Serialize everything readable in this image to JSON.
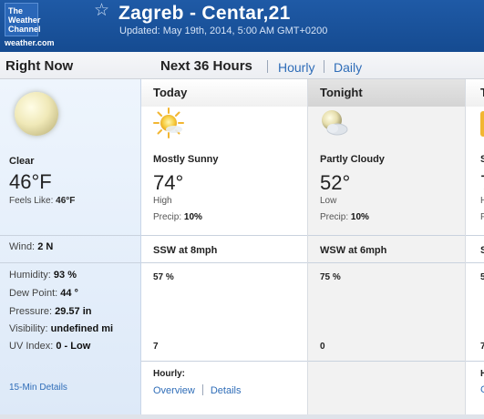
{
  "header": {
    "logo_line1": "The",
    "logo_line2": "Weather",
    "logo_line3": "Channel",
    "logo_url": "weather.com",
    "star_icon": "star-outline-icon",
    "city": "Zagreb - Centar,21",
    "updated": "Updated: May 19th, 2014, 5:00 AM GMT+0200"
  },
  "nav": {
    "right_now": "Right Now",
    "next36": "Next 36 Hours",
    "hourly": "Hourly",
    "daily": "Daily"
  },
  "right_now": {
    "icon": "full-moon-icon",
    "condition": "Clear",
    "temp": "46°F",
    "feels_label": "Feels Like:",
    "feels_value": "46°F",
    "wind_label": "Wind:",
    "wind_value": "2 N",
    "humidity_label": "Humidity:",
    "humidity_value": "93 %",
    "dewpoint_label": "Dew Point:",
    "dewpoint_value": "44 °",
    "pressure_label": "Pressure:",
    "pressure_value": "29.57 in",
    "visibility_label": "Visibility:",
    "visibility_value": "undefined mi",
    "uv_label": "UV Index:",
    "uv_value": "0 - Low",
    "details_link": "15-Min Details"
  },
  "today": {
    "title": "Today",
    "icon": "mostly-sunny-icon",
    "condition": "Mostly Sunny",
    "temp": "74°",
    "hl": "High",
    "precip_label": "Precip:",
    "precip_value": "10%",
    "wind": "SSW at 8mph",
    "humidity": "57 %",
    "uv": "7",
    "hourly_label": "Hourly:",
    "overview_link": "Overview",
    "details_link": "Details"
  },
  "tonight": {
    "title": "Tonight",
    "icon": "partly-cloudy-night-icon",
    "condition": "Partly Cloudy",
    "temp": "52°",
    "hl": "Low",
    "precip_label": "Precip:",
    "precip_value": "10%",
    "wind": "WSW at 6mph",
    "humidity": "75 %",
    "uv": "0"
  },
  "tomorrow_partial": {
    "title": "T",
    "condition": "S",
    "temp": "7",
    "hl": "H",
    "precip": "P",
    "wind": "S",
    "humidity": "5",
    "uv": "7",
    "hourly": "H",
    "link": "C"
  },
  "colors": {
    "header_bg": "#1f5aa6",
    "link": "#2f6db8",
    "rightnow_bg": "#e6effa",
    "tonight_bg": "#f2f2f2"
  }
}
